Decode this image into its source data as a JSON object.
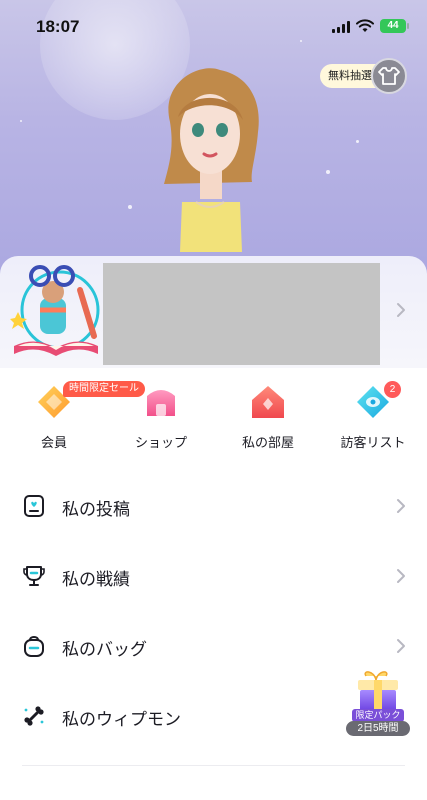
{
  "status_bar": {
    "time": "18:07",
    "battery": "44"
  },
  "hero": {
    "free_lottery": "無料抽選"
  },
  "quick_menu": {
    "sale_tag": "時間限定セール",
    "visitor_count": "2",
    "items": [
      {
        "label": "会員",
        "icon": "diamond-icon"
      },
      {
        "label": "ショップ",
        "icon": "shop-icon"
      },
      {
        "label": "私の部屋",
        "icon": "room-icon"
      },
      {
        "label": "訪客リスト",
        "icon": "visitor-icon"
      }
    ]
  },
  "menu_rows": [
    {
      "label": "私の投稿",
      "icon": "post-icon"
    },
    {
      "label": "私の戦績",
      "icon": "trophy-icon"
    },
    {
      "label": "私のバッグ",
      "icon": "bag-icon"
    },
    {
      "label": "私のウィプモン",
      "icon": "bone-icon"
    }
  ],
  "limited_pack": {
    "label": "限定パック",
    "timer": "2日5時間"
  },
  "colors": {
    "accent_red": "#ff5a48",
    "hero_bg": "#b8b4e4"
  }
}
